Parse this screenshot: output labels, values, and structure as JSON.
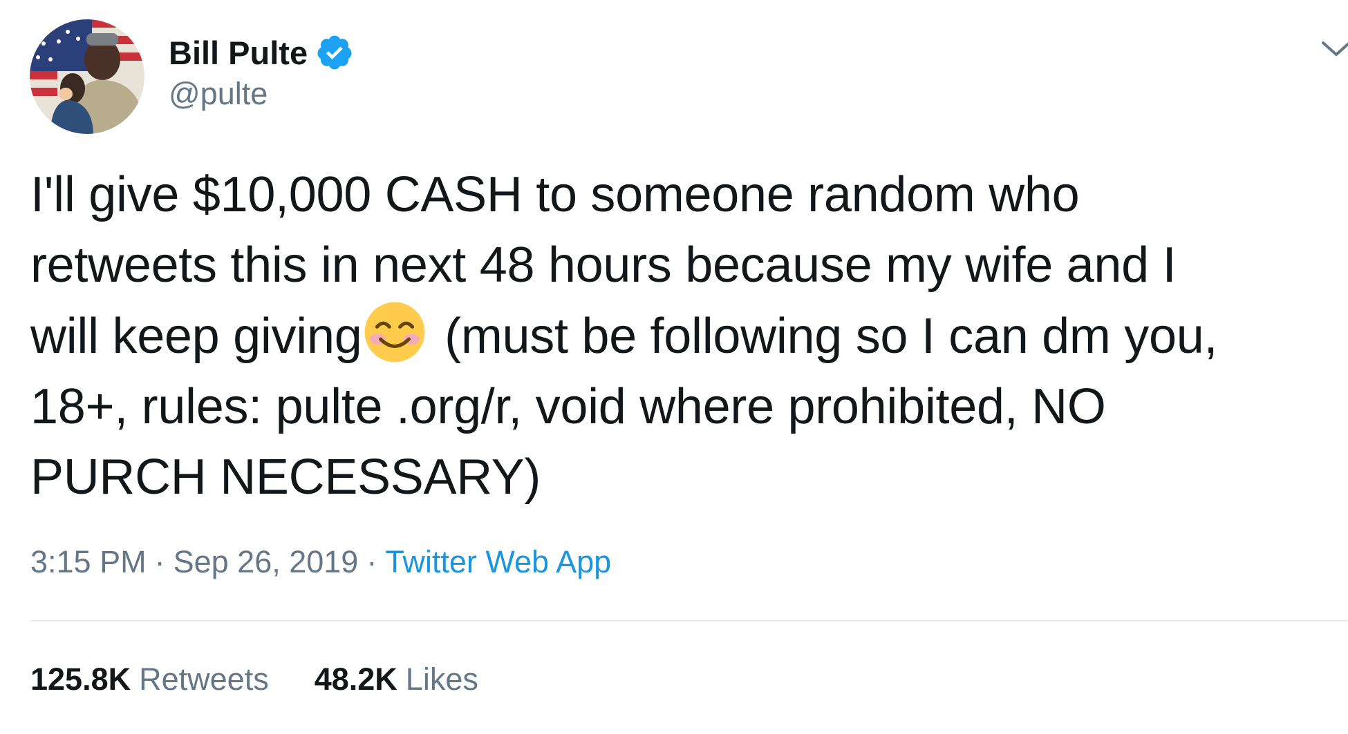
{
  "tweet": {
    "author": {
      "display_name": "Bill Pulte",
      "handle": "@pulte",
      "verified": true,
      "avatar_icon": "profile-photo"
    },
    "text_before_emoji": "I'll give $10,000 CASH to someone random who\nretweets this in next 48 hours because my wife and I\nwill keep giving",
    "emoji": "smiling-face-with-smiling-eyes",
    "text_after_emoji": " (must be following so I can dm you,\n18+, rules: pulte .org/r, void where prohibited, NO\nPURCH NECESSARY)",
    "time": "3:15 PM",
    "separator": "·",
    "date": "Sep 26, 2019",
    "source": "Twitter Web App",
    "stats": [
      {
        "count": "125.8K",
        "label": "Retweets"
      },
      {
        "count": "48.2K",
        "label": "Likes"
      }
    ]
  },
  "colors": {
    "text_primary": "#14171a",
    "text_secondary": "#657786",
    "link": "#1b95e0",
    "verified_badge": "#1da1f2",
    "divider": "#e6ecf0"
  }
}
